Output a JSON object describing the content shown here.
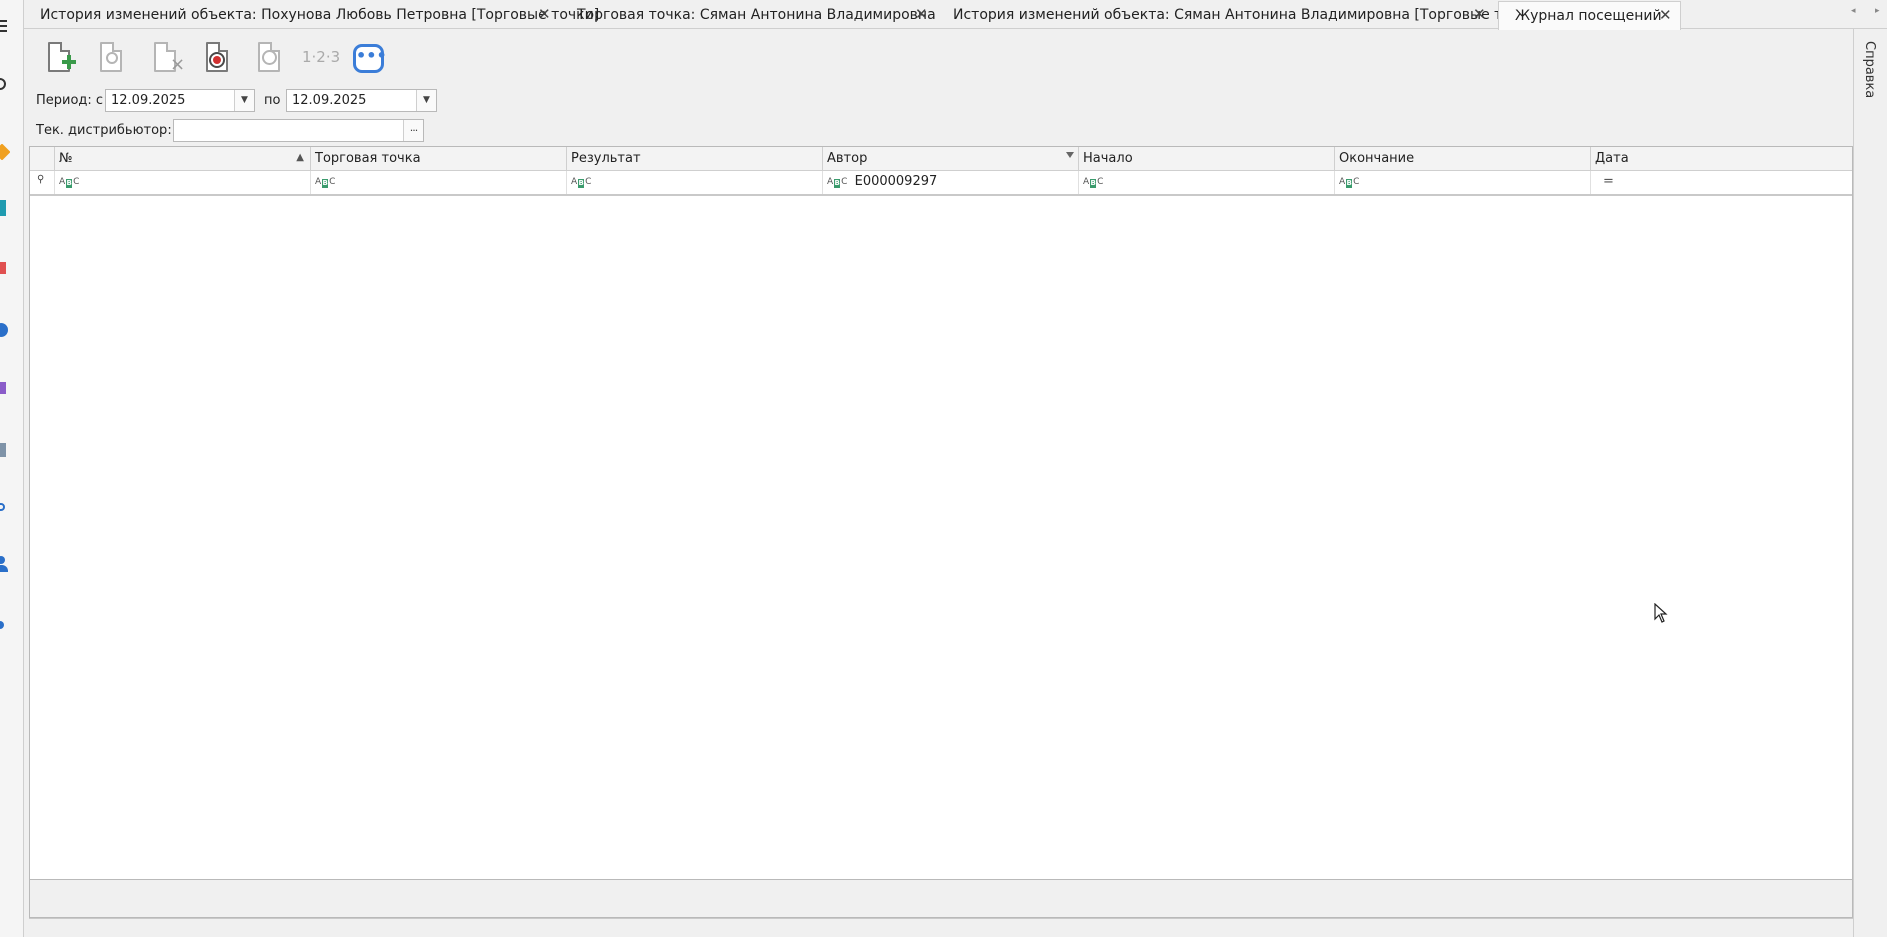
{
  "tabs": [
    {
      "label": "История изменений объекта: Похунова Любовь Петровна [Торговые точки]",
      "close": "✕"
    },
    {
      "label": "Торговая точка:  Сяман Антонина Владимировна",
      "close": "✕"
    },
    {
      "label": "История изменений объекта: Сяман Антонина Владимировна [Торговые точки]",
      "close": "✕"
    },
    {
      "label": "Журнал посещений",
      "close": "✕"
    }
  ],
  "tab_nav": {
    "prev": "◂",
    "next": "▸"
  },
  "right_rail": {
    "label": "Справка"
  },
  "toolbar": {
    "icons": [
      "new-document-icon",
      "view-document-icon",
      "delete-document-icon",
      "cancel-search-icon",
      "history-icon",
      "numbering-icon",
      "more-icon"
    ],
    "numbering_label": "1·2·3"
  },
  "filters": {
    "period_label": "Период: с",
    "period_from": "12.09.2025",
    "to_label": "по",
    "period_to": "12.09.2025",
    "distributor_label": "Тек. дистрибьютор:",
    "distributor_value": "",
    "ellipsis": "···",
    "dropdown": "▼"
  },
  "grid": {
    "columns": [
      "№",
      "Торговая точка",
      "Результат",
      "Автор",
      "Начало",
      "Окончание",
      "Дата"
    ],
    "sort_indicator": "▲",
    "filter_row": {
      "abc_prefix": "A",
      "abc_mid": "B",
      "abc_suffix": "C",
      "author_value": "E000009297",
      "date_operator": "="
    }
  },
  "colors": {
    "accent": "#3b7dd8",
    "green": "#3b9b6d"
  }
}
